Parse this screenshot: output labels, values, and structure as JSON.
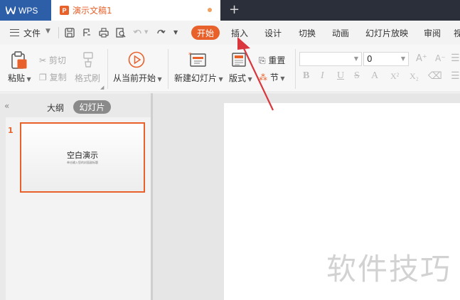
{
  "titlebar": {
    "app_label": "WPS",
    "doc_tab_title": "演示文稿1",
    "new_tab_symbol": "+"
  },
  "menubar": {
    "file_label": "文件",
    "tabs": [
      "开始",
      "插入",
      "设计",
      "切换",
      "动画",
      "幻灯片放映",
      "审阅",
      "视"
    ]
  },
  "ribbon": {
    "paste": "粘贴",
    "cut": "剪切",
    "copy": "复制",
    "format_painter": "格式刷",
    "play_from_current": "从当前开始",
    "new_slide": "新建幻灯片",
    "layout": "版式",
    "reset": "重置",
    "section": "节",
    "font_size_value": "0",
    "format_buttons": [
      "B",
      "I",
      "U",
      "S",
      "A",
      "X²",
      "X₂"
    ]
  },
  "left_panel": {
    "tab_outline": "大纲",
    "tab_slides": "幻灯片",
    "slide_number": "1",
    "thumb_title": "空白演示",
    "thumb_subtitle": "单击输入您的封面副标题"
  },
  "watermark": "软件技巧",
  "colors": {
    "accent": "#e8612b",
    "wps_blue": "#2d5fa8",
    "titlebar_bg": "#2b2f3a",
    "arrow": "#d9363e"
  }
}
